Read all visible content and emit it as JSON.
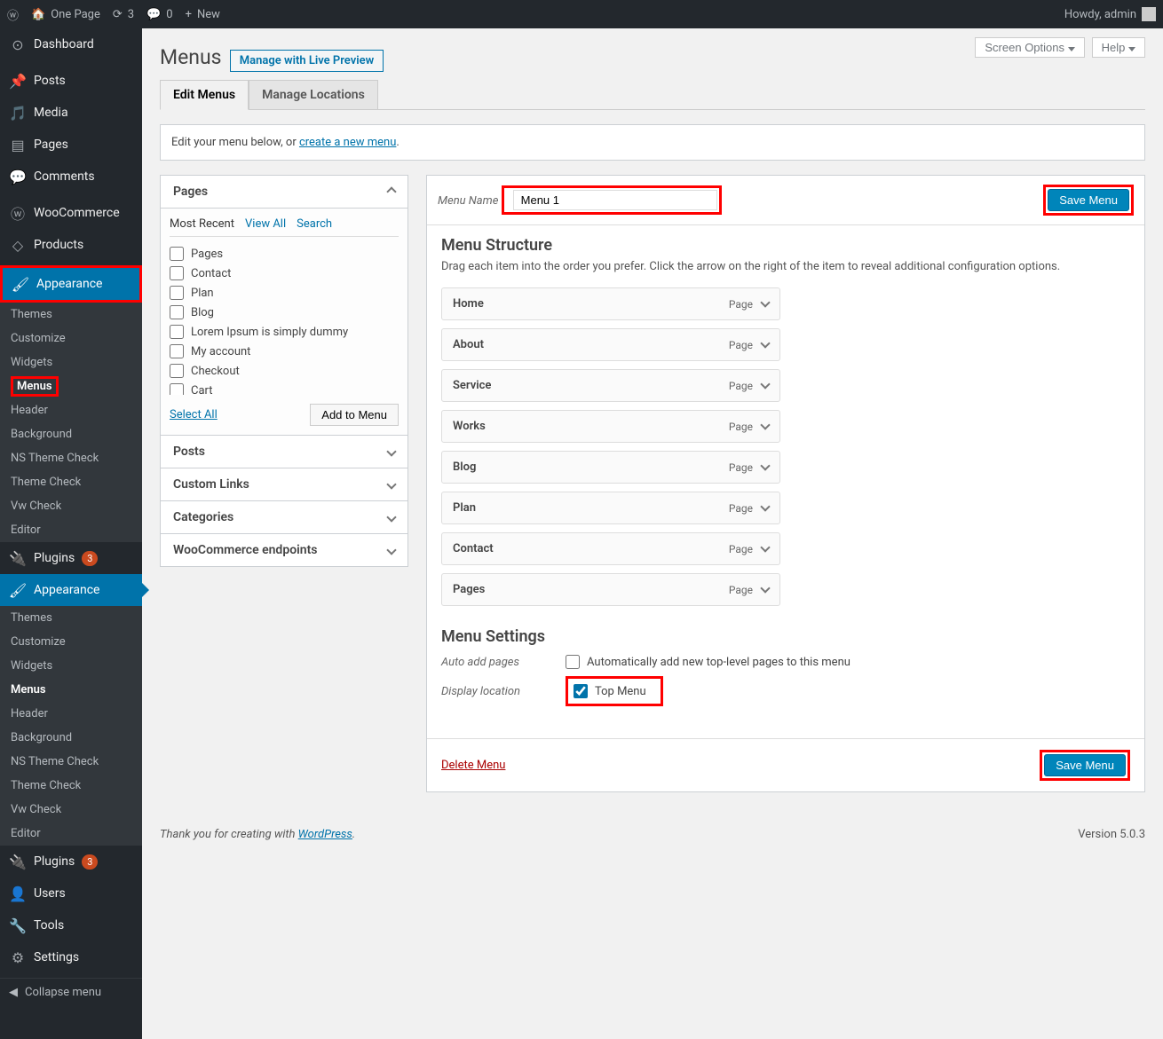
{
  "adminbar": {
    "site": "One Page",
    "updates": "3",
    "comments": "0",
    "new": "New",
    "howdy": "Howdy, admin"
  },
  "sidebar": {
    "dashboard": "Dashboard",
    "posts": "Posts",
    "media": "Media",
    "pages": "Pages",
    "comments": "Comments",
    "woocommerce": "WooCommerce",
    "products": "Products",
    "appearance": "Appearance",
    "appearance_sub": {
      "themes": "Themes",
      "customize": "Customize",
      "widgets": "Widgets",
      "menus": "Menus",
      "header": "Header",
      "background": "Background",
      "ns_theme_check": "NS Theme Check",
      "theme_check": "Theme Check",
      "vw_check": "Vw Check",
      "editor": "Editor"
    },
    "plugins": "Plugins",
    "plugins_badge": "3",
    "users": "Users",
    "tools": "Tools",
    "settings": "Settings",
    "collapse": "Collapse menu"
  },
  "screen_options": "Screen Options",
  "help": "Help",
  "page_title": "Menus",
  "live_preview": "Manage with Live Preview",
  "tabs": {
    "edit": "Edit Menus",
    "locations": "Manage Locations"
  },
  "notice": {
    "text": "Edit your menu below, or ",
    "link": "create a new menu"
  },
  "left": {
    "pages_heading": "Pages",
    "tabs": {
      "most_recent": "Most Recent",
      "view_all": "View All",
      "search": "Search"
    },
    "items": [
      "Pages",
      "Contact",
      "Plan",
      "Blog",
      "Lorem Ipsum is simply dummy",
      "My account",
      "Checkout",
      "Cart"
    ],
    "select_all": "Select All",
    "add_to_menu": "Add to Menu",
    "posts_heading": "Posts",
    "custom_links_heading": "Custom Links",
    "categories_heading": "Categories",
    "woo_heading": "WooCommerce endpoints"
  },
  "menu": {
    "name_label": "Menu Name",
    "name_value": "Menu 1",
    "save": "Save Menu",
    "structure_heading": "Menu Structure",
    "structure_desc": "Drag each item into the order you prefer. Click the arrow on the right of the item to reveal additional configuration options.",
    "items": [
      {
        "title": "Home",
        "type": "Page"
      },
      {
        "title": "About",
        "type": "Page"
      },
      {
        "title": "Service",
        "type": "Page"
      },
      {
        "title": "Works",
        "type": "Page"
      },
      {
        "title": "Blog",
        "type": "Page"
      },
      {
        "title": "Plan",
        "type": "Page"
      },
      {
        "title": "Contact",
        "type": "Page"
      },
      {
        "title": "Pages",
        "type": "Page"
      }
    ],
    "settings_heading": "Menu Settings",
    "auto_add_label": "Auto add pages",
    "auto_add_check": "Automatically add new top-level pages to this menu",
    "display_loc_label": "Display location",
    "top_menu": "Top Menu",
    "delete": "Delete Menu"
  },
  "footer": {
    "thanks": "Thank you for creating with ",
    "wp": "WordPress",
    "version": "Version 5.0.3"
  }
}
